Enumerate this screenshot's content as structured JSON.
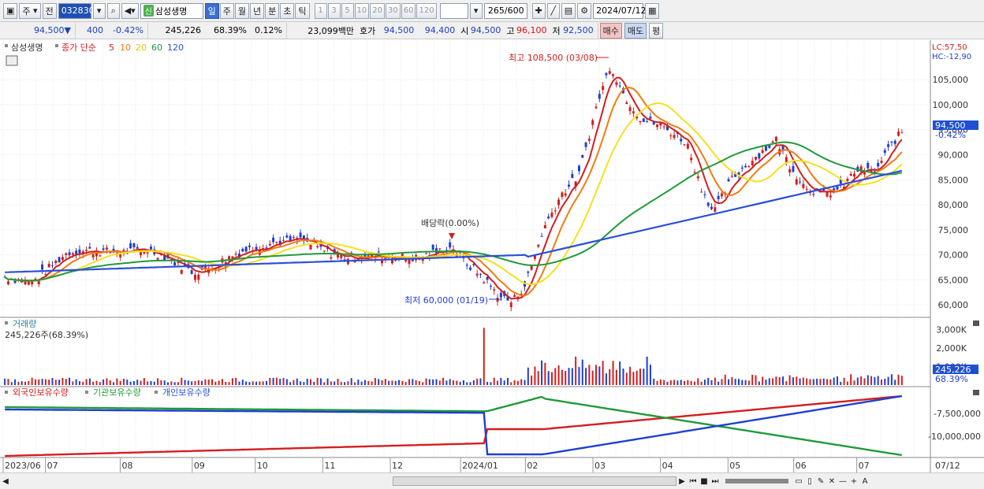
{
  "toolbar": {
    "type_label": "주",
    "prev_label": "전",
    "code": "032830",
    "badge": "신",
    "stock_name": "삼성생명",
    "periods": [
      "일",
      "주",
      "월",
      "년",
      "분",
      "초",
      "틱"
    ],
    "selected_period": "일",
    "intervals": [
      "1",
      "3",
      "5",
      "10",
      "20",
      "30",
      "60",
      "120"
    ],
    "count": "265",
    "count_max": "/600",
    "date": "2024/07/12"
  },
  "info": {
    "price": "94,500▼",
    "change": "400",
    "change_pct": "-0.42%",
    "volume": "245,226",
    "vol_ratio": "68.39%",
    "turnover": "0.12%",
    "amount": "23,099백만",
    "quote_label": "호가",
    "ask": "94,500",
    "bid": "94,400",
    "open_label": "시",
    "open": "94,500",
    "high_label": "고",
    "high": "96,100",
    "low_label": "저",
    "low": "92,500",
    "buy_btn": "매수",
    "sell_btn": "매도",
    "eval_btn": "평"
  },
  "price_panel": {
    "legend_name": "삼성생명",
    "legend_ma": "종가 단순",
    "ma_periods": [
      "5",
      "10",
      "20",
      "60",
      "120"
    ],
    "lc": "LC:57,50",
    "hc": "HC:-12,90",
    "annot_high": "최고 108,500 (03/08)",
    "annot_low": "최저 60,000 (01/19)",
    "annot_div": "배당락(0.00%)",
    "current_price": "94,500",
    "current_pct": "-0.42%",
    "y_ticks": [
      "105,000",
      "100,000",
      "95,000",
      "90,000",
      "85,000",
      "80,000",
      "75,000",
      "70,000",
      "65,000",
      "60,000"
    ]
  },
  "volume_panel": {
    "title": "거래량",
    "value": "245,226주(68.39%)",
    "y_ticks": [
      "3,000K",
      "2,000K",
      "1,000K"
    ],
    "current": "245,226",
    "current_pct": "68.39%"
  },
  "holdings_panel": {
    "foreign": "외국인보유수량",
    "institution": "기관보유수량",
    "individual": "개인보유수량",
    "y_ticks": [
      "-7,500,000",
      "-10,000,000"
    ]
  },
  "x_labels": [
    "2023/06",
    "07",
    "08",
    "09",
    "10",
    "11",
    "12",
    "2024/01",
    "02",
    "03",
    "04",
    "05",
    "06",
    "07",
    "07/12"
  ],
  "colors": {
    "up": "#d21f1f",
    "down": "#1f3fd0",
    "ma5": "#d21f1f",
    "ma10": "#f07c10",
    "ma20": "#f5e020",
    "ma60": "#1f9a3a",
    "ma120": "#2b4fd8"
  },
  "chart_data": {
    "type": "line",
    "title": "",
    "x": [
      "2023/06",
      "07",
      "08",
      "09",
      "10",
      "11",
      "12",
      "2024/01",
      "02",
      "03",
      "04",
      "05",
      "06",
      "07",
      "07/12"
    ],
    "ylim": [
      57500,
      112900
    ],
    "series": [
      {
        "name": "종가",
        "values": [
          65500,
          67500,
          71000,
          67000,
          72000,
          71000,
          70500,
          62500,
          74500,
          104000,
          91000,
          91000,
          83000,
          87500,
          94500
        ]
      },
      {
        "name": "120",
        "values": [
          66500,
          67000,
          67500,
          68000,
          69000,
          69500,
          70000,
          69500,
          69000,
          71000,
          77000,
          81000,
          83500,
          85500,
          86800
        ]
      }
    ],
    "annotations": [
      "최고 108,500 (03/08)",
      "최저 60,000 (01/19)",
      "배당락(0.00%)"
    ]
  }
}
